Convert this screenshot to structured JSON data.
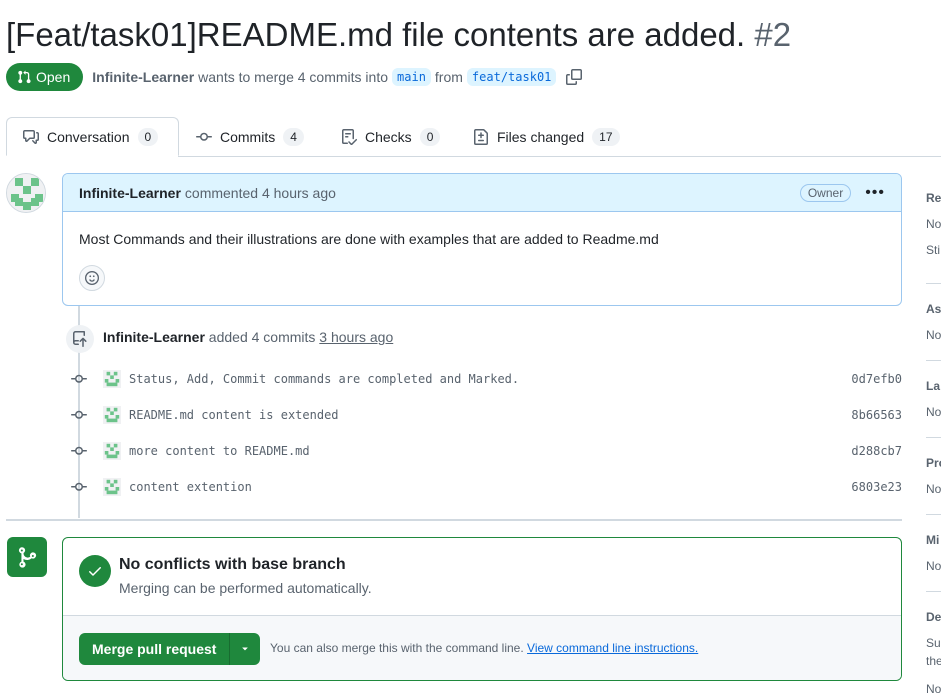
{
  "pr": {
    "title": "[Feat/task01]README.md file contents are added.",
    "number": "#2",
    "state": "Open",
    "author": "Infinite-Learner",
    "merge_text_1": "wants to merge 4 commits into",
    "base_branch": "main",
    "merge_text_2": "from",
    "head_branch": "feat/task01"
  },
  "tabs": [
    {
      "label": "Conversation",
      "count": "0"
    },
    {
      "label": "Commits",
      "count": "4"
    },
    {
      "label": "Checks",
      "count": "0"
    },
    {
      "label": "Files changed",
      "count": "17"
    }
  ],
  "comment": {
    "author": "Infinite-Learner",
    "action": "commented 4 hours ago",
    "badge": "Owner",
    "body": "Most Commands and their illustrations are done with examples that are added to Readme.md"
  },
  "commit_event": {
    "author": "Infinite-Learner",
    "action": "added 4 commits",
    "time": "3 hours ago"
  },
  "commits": [
    {
      "message": "Status, Add, Commit commands are completed and Marked.",
      "sha": "0d7efb0"
    },
    {
      "message": "README.md content is extended",
      "sha": "8b66563"
    },
    {
      "message": "more content to README.md",
      "sha": "d288cb7"
    },
    {
      "message": "content extention",
      "sha": "6803e23"
    }
  ],
  "merge": {
    "title": "No conflicts with base branch",
    "subtitle": "Merging can be performed automatically.",
    "button": "Merge pull request",
    "hint": "You can also merge this with the command line.",
    "hint_link": "View command line instructions."
  },
  "sidebar": [
    {
      "heading": "Re",
      "lines": [
        "No",
        "Sti"
      ]
    },
    {
      "heading": "As",
      "lines": [
        "No"
      ]
    },
    {
      "heading": "La",
      "lines": [
        "No"
      ]
    },
    {
      "heading": "Pro",
      "lines": [
        "No"
      ]
    },
    {
      "heading": "Mi",
      "lines": [
        "No"
      ]
    },
    {
      "heading": "De",
      "lines": [
        "Suc",
        "the",
        "No"
      ]
    }
  ],
  "colors": {
    "open_green": "#1f883d",
    "link_blue": "#0969da",
    "comment_header_bg": "#ddf4ff"
  }
}
